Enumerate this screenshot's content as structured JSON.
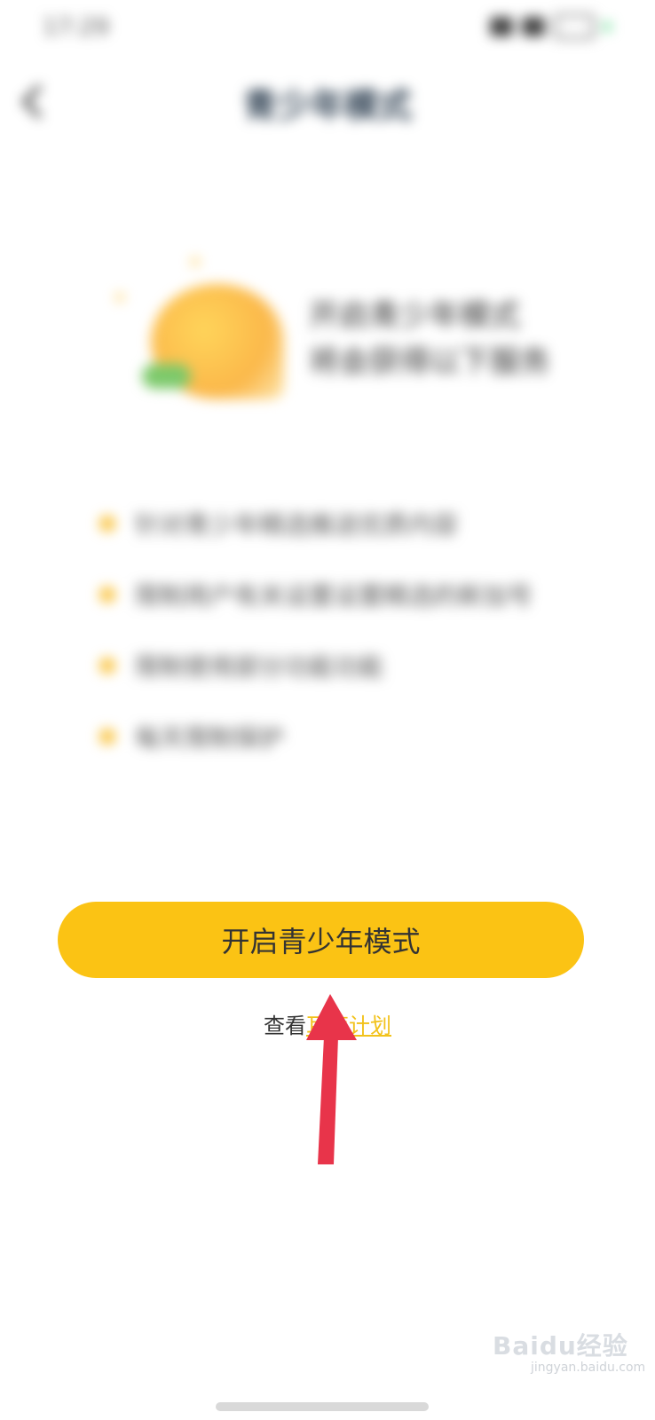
{
  "status_bar": {
    "time": "17:29"
  },
  "header": {
    "title": "青少年模式"
  },
  "hero": {
    "line1": "开启青少年模式",
    "line2": "将会获得以下服务"
  },
  "features": [
    {
      "text": "针对青少年精选推送优质内容"
    },
    {
      "text": "限制用户有关设置设置精选的新加号"
    },
    {
      "text": "限制使用部分功能功能"
    },
    {
      "text": "每天限制保护"
    }
  ],
  "actions": {
    "enable_button": "开启青少年模式",
    "footer_prefix": "查看",
    "footer_link": "耳萌计划"
  },
  "watermark": {
    "brand": "Baidu经验",
    "url": "jingyan.baidu.com"
  },
  "colors": {
    "accent": "#fbc314",
    "link": "#f2c21b",
    "arrow": "#e8344a"
  }
}
